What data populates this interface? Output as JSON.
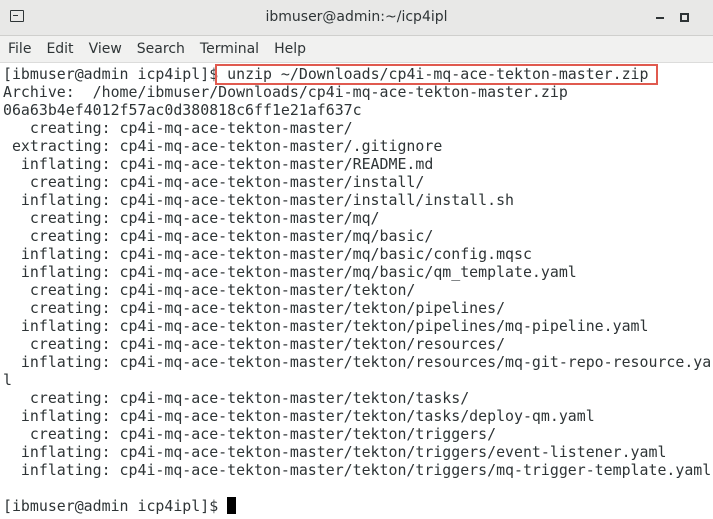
{
  "window": {
    "title": "ibmuser@admin:~/icp4ipl",
    "app_icon": "terminal-icon",
    "controls": [
      "minimize-icon",
      "maximize-icon"
    ]
  },
  "menu": {
    "items": [
      {
        "label": "File"
      },
      {
        "label": "Edit"
      },
      {
        "label": "View"
      },
      {
        "label": "Search"
      },
      {
        "label": "Terminal"
      },
      {
        "label": "Help"
      }
    ]
  },
  "terminal": {
    "prompt": "[ibmuser@admin icp4ipl]$",
    "command": "unzip ~/Downloads/cp4i-mq-ace-tekton-master.zip",
    "output": [
      "Archive:  /home/ibmuser/Downloads/cp4i-mq-ace-tekton-master.zip",
      "06a63b4ef4012f57ac0d380818c6ff1e21af637c",
      "   creating: cp4i-mq-ace-tekton-master/",
      " extracting: cp4i-mq-ace-tekton-master/.gitignore",
      "  inflating: cp4i-mq-ace-tekton-master/README.md",
      "   creating: cp4i-mq-ace-tekton-master/install/",
      "  inflating: cp4i-mq-ace-tekton-master/install/install.sh",
      "   creating: cp4i-mq-ace-tekton-master/mq/",
      "   creating: cp4i-mq-ace-tekton-master/mq/basic/",
      "  inflating: cp4i-mq-ace-tekton-master/mq/basic/config.mqsc",
      "  inflating: cp4i-mq-ace-tekton-master/mq/basic/qm_template.yaml",
      "   creating: cp4i-mq-ace-tekton-master/tekton/",
      "   creating: cp4i-mq-ace-tekton-master/tekton/pipelines/",
      "  inflating: cp4i-mq-ace-tekton-master/tekton/pipelines/mq-pipeline.yaml",
      "   creating: cp4i-mq-ace-tekton-master/tekton/resources/",
      "  inflating: cp4i-mq-ace-tekton-master/tekton/resources/mq-git-repo-resource.ya",
      "l",
      "   creating: cp4i-mq-ace-tekton-master/tekton/tasks/",
      "  inflating: cp4i-mq-ace-tekton-master/tekton/tasks/deploy-qm.yaml",
      "   creating: cp4i-mq-ace-tekton-master/tekton/triggers/",
      "  inflating: cp4i-mq-ace-tekton-master/tekton/triggers/event-listener.yaml",
      "  inflating: cp4i-mq-ace-tekton-master/tekton/triggers/mq-trigger-template.yaml",
      ""
    ],
    "final_prompt": "[ibmuser@admin icp4ipl]$",
    "highlight_color": "#e05a4f"
  }
}
